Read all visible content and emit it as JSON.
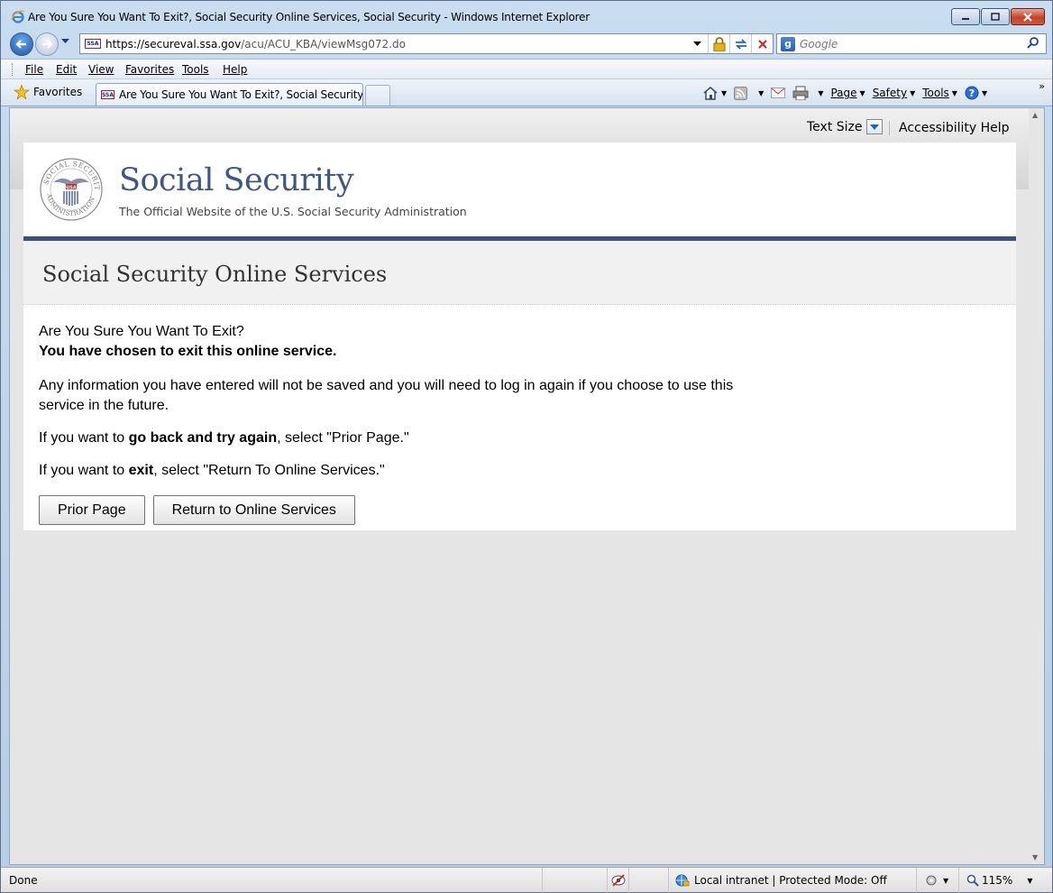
{
  "window": {
    "title": "Are You Sure You Want To Exit?, Social Security Online Services, Social Security - Windows Internet Explorer"
  },
  "address": {
    "url_host": "https://secureval.ssa.gov",
    "url_path": "/acu/ACU_KBA/viewMsg072.do",
    "favicon_text": "SSA"
  },
  "search": {
    "placeholder": "Google"
  },
  "menu": {
    "items": [
      "File",
      "Edit",
      "View",
      "Favorites",
      "Tools",
      "Help"
    ]
  },
  "tabs": {
    "favorites_label": "Favorites",
    "active_tab_label": "Are You Sure You Want To Exit?, Social Security O..."
  },
  "commandbar": {
    "page": "Page",
    "safety": "Safety",
    "tools": "Tools"
  },
  "utility": {
    "text_size": "Text Size",
    "accessibility_help": "Accessibility Help"
  },
  "header": {
    "brand": "Social Security",
    "tagline": "The Official Website of the U.S. Social Security Administration"
  },
  "section": {
    "title": "Social Security Online Services"
  },
  "content": {
    "question": "Are You Sure You Want To Exit?",
    "bold_line": "You have chosen to exit this online service.",
    "info": "Any information you have entered will not be saved and you will need to log in again if you choose to use this service in the future.",
    "back_prefix": "If you want to ",
    "back_bold": "go back and try again",
    "back_suffix": ", select \"Prior Page.\"",
    "exit_prefix": "If you want to ",
    "exit_bold": "exit",
    "exit_suffix": ", select \"Return To Online Services.\""
  },
  "buttons": {
    "prior": "Prior Page",
    "return": "Return to Online Services"
  },
  "statusbar": {
    "status": "Done",
    "zone": "Local intranet | Protected Mode: Off",
    "zoom": "115%"
  },
  "colors": {
    "brand_blue": "#3f5687",
    "rule_blue": "#3e5278"
  }
}
